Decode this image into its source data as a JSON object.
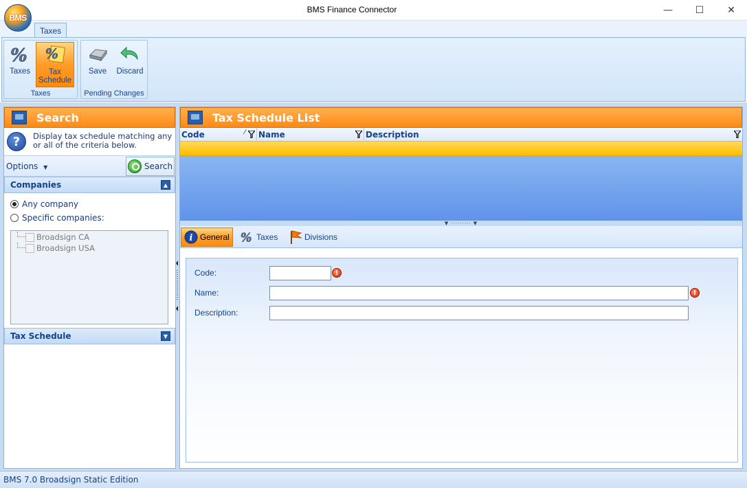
{
  "window": {
    "title": "BMS Finance Connector",
    "logo_text": "BMS",
    "controls": {
      "minimize": "—",
      "maximize": "☐",
      "close": "✕"
    }
  },
  "ribbon": {
    "tabs": [
      {
        "label": "Taxes"
      }
    ],
    "groups": [
      {
        "label": "Taxes",
        "buttons": [
          {
            "label": "Taxes",
            "icon": "percent-icon"
          },
          {
            "label": "Tax Schedule",
            "icon": "tax-schedule-icon",
            "active": true
          }
        ]
      },
      {
        "label": "Pending Changes",
        "buttons": [
          {
            "label": "Save",
            "icon": "save-icon"
          },
          {
            "label": "Discard",
            "icon": "undo-icon"
          }
        ]
      }
    ]
  },
  "search_panel": {
    "title": "Search",
    "info_text": "Display tax schedule matching any or all of the criteria below.",
    "options_label": "Options",
    "search_button": "Search",
    "companies": {
      "title": "Companies",
      "options": [
        {
          "label": "Any company",
          "selected": true
        },
        {
          "label": "Specific companies:",
          "selected": false
        }
      ],
      "list": [
        "Broadsign CA",
        "Broadsign USA"
      ]
    },
    "tax_schedule_section": "Tax Schedule"
  },
  "list_panel": {
    "title": "Tax Schedule List",
    "columns": [
      "Code",
      "Name",
      "Description"
    ]
  },
  "detail_tabs": [
    {
      "label": "General",
      "icon": "info-icon",
      "active": true
    },
    {
      "label": "Taxes",
      "icon": "percent-icon"
    },
    {
      "label": "Divisions",
      "icon": "flag-icon"
    }
  ],
  "form": {
    "code_label": "Code:",
    "name_label": "Name:",
    "description_label": "Description:",
    "code_value": "",
    "name_value": "",
    "description_value": "",
    "error_glyph": "!"
  },
  "status_bar": {
    "text": "BMS 7.0 Broadsign Static Edition"
  },
  "colors": {
    "accent_orange": "#ff8a14",
    "ribbon_blue": "#15428b",
    "selected_row": "#ffbe00",
    "grid_blue": "#5f93e8"
  }
}
